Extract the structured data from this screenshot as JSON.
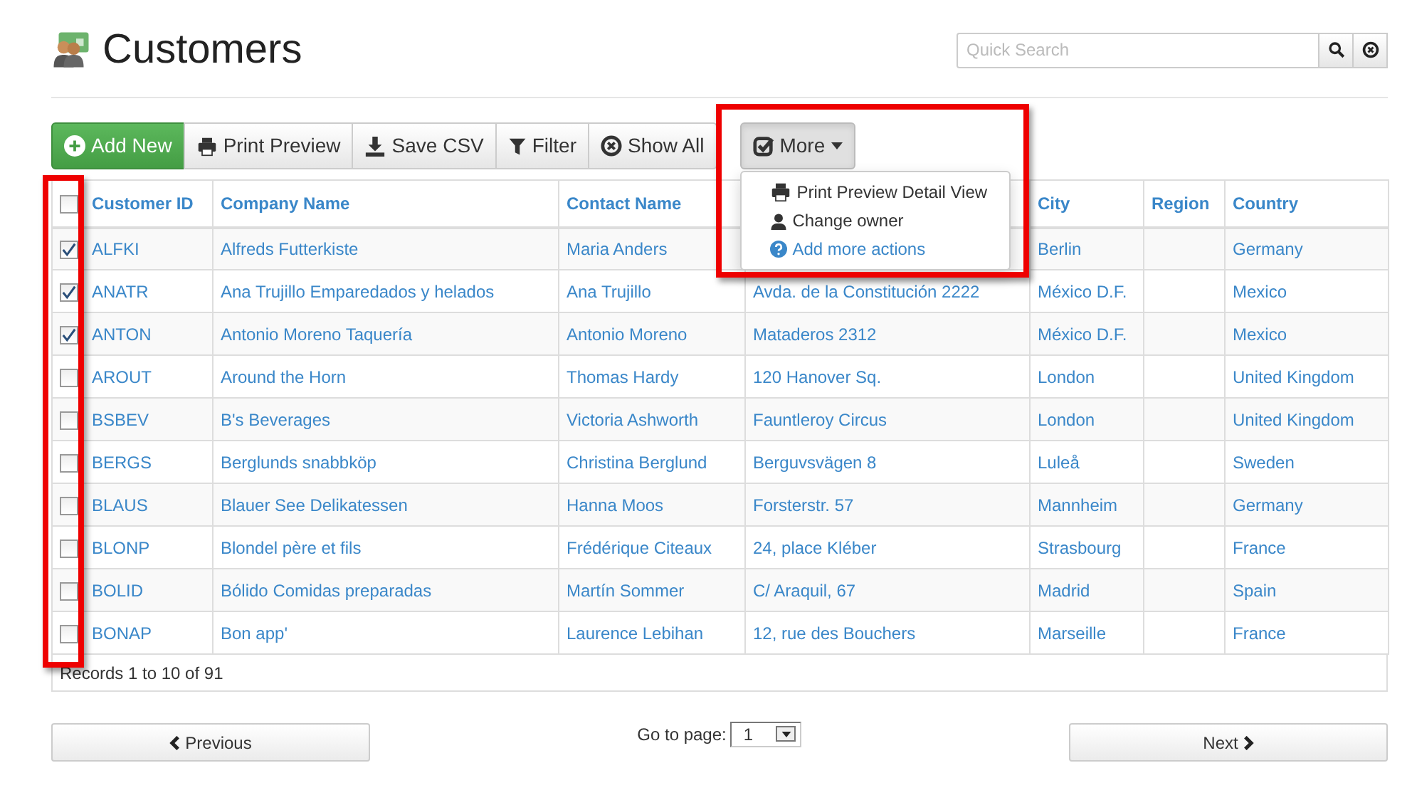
{
  "page": {
    "title": "Customers"
  },
  "search": {
    "placeholder": "Quick Search"
  },
  "toolbar": [
    {
      "kind": "add",
      "label": "Add New"
    },
    {
      "kind": "print",
      "label": "Print Preview"
    },
    {
      "kind": "csv",
      "label": "Save CSV"
    },
    {
      "kind": "filter",
      "label": "Filter"
    },
    {
      "kind": "showall",
      "label": "Show All"
    }
  ],
  "more_menu": {
    "label": "More",
    "expanded": true,
    "highlighted": true,
    "items": [
      {
        "kind": "print",
        "label": "Print Preview Detail View"
      },
      {
        "kind": "owner",
        "label": "Change owner"
      },
      {
        "kind": "help",
        "label": "Add more actions"
      }
    ]
  },
  "table": {
    "checkbox_column_highlighted": true,
    "select_all": {
      "checked": false
    },
    "columns": [
      {
        "label": "Customer ID"
      },
      {
        "label": "Company Name"
      },
      {
        "label": "Contact Name"
      },
      {},
      {
        "label": "City"
      },
      {
        "label": "Region"
      },
      {
        "label": "Country"
      }
    ],
    "rows": [
      {
        "checked": true,
        "cells": [
          "ALFKI",
          "Alfreds Futterkiste",
          "Maria Anders",
          null,
          "Berlin",
          "",
          "Germany"
        ]
      },
      {
        "checked": true,
        "cells": [
          "ANATR",
          "Ana Trujillo Emparedados y helados",
          "Ana Trujillo",
          "Avda. de la Constitución 2222",
          "México D.F.",
          "",
          "Mexico"
        ]
      },
      {
        "checked": true,
        "cells": [
          "ANTON",
          "Antonio Moreno Taquería",
          "Antonio Moreno",
          "Mataderos 2312",
          "México D.F.",
          "",
          "Mexico"
        ]
      },
      {
        "checked": false,
        "cells": [
          "AROUT",
          "Around the Horn",
          "Thomas Hardy",
          "120 Hanover Sq.",
          "London",
          "",
          "United Kingdom"
        ]
      },
      {
        "checked": false,
        "cells": [
          "BSBEV",
          "B's Beverages",
          "Victoria Ashworth",
          "Fauntleroy Circus",
          "London",
          "",
          "United Kingdom"
        ]
      },
      {
        "checked": false,
        "cells": [
          "BERGS",
          "Berglunds snabbköp",
          "Christina Berglund",
          "Berguvsvägen 8",
          "Luleå",
          "",
          "Sweden"
        ]
      },
      {
        "checked": false,
        "cells": [
          "BLAUS",
          "Blauer See Delikatessen",
          "Hanna Moos",
          "Forsterstr. 57",
          "Mannheim",
          "",
          "Germany"
        ]
      },
      {
        "checked": false,
        "cells": [
          "BLONP",
          "Blondel père et fils",
          "Frédérique Citeaux",
          "24, place Kléber",
          "Strasbourg",
          "",
          "France"
        ]
      },
      {
        "checked": false,
        "cells": [
          "BOLID",
          "Bólido Comidas preparadas",
          "Martín Sommer",
          "C/ Araquil, 67",
          "Madrid",
          "",
          "Spain"
        ]
      },
      {
        "checked": false,
        "cells": [
          "BONAP",
          "Bon app'",
          "Laurence Lebihan",
          "12, rue des Bouchers",
          "Marseille",
          "",
          "France"
        ]
      }
    ],
    "footer": "Records 1 to 10 of 91"
  },
  "pagination": {
    "previous": "Previous",
    "go_to_page": {
      "label": "Go to page:",
      "value": "1"
    },
    "next": "Next"
  }
}
